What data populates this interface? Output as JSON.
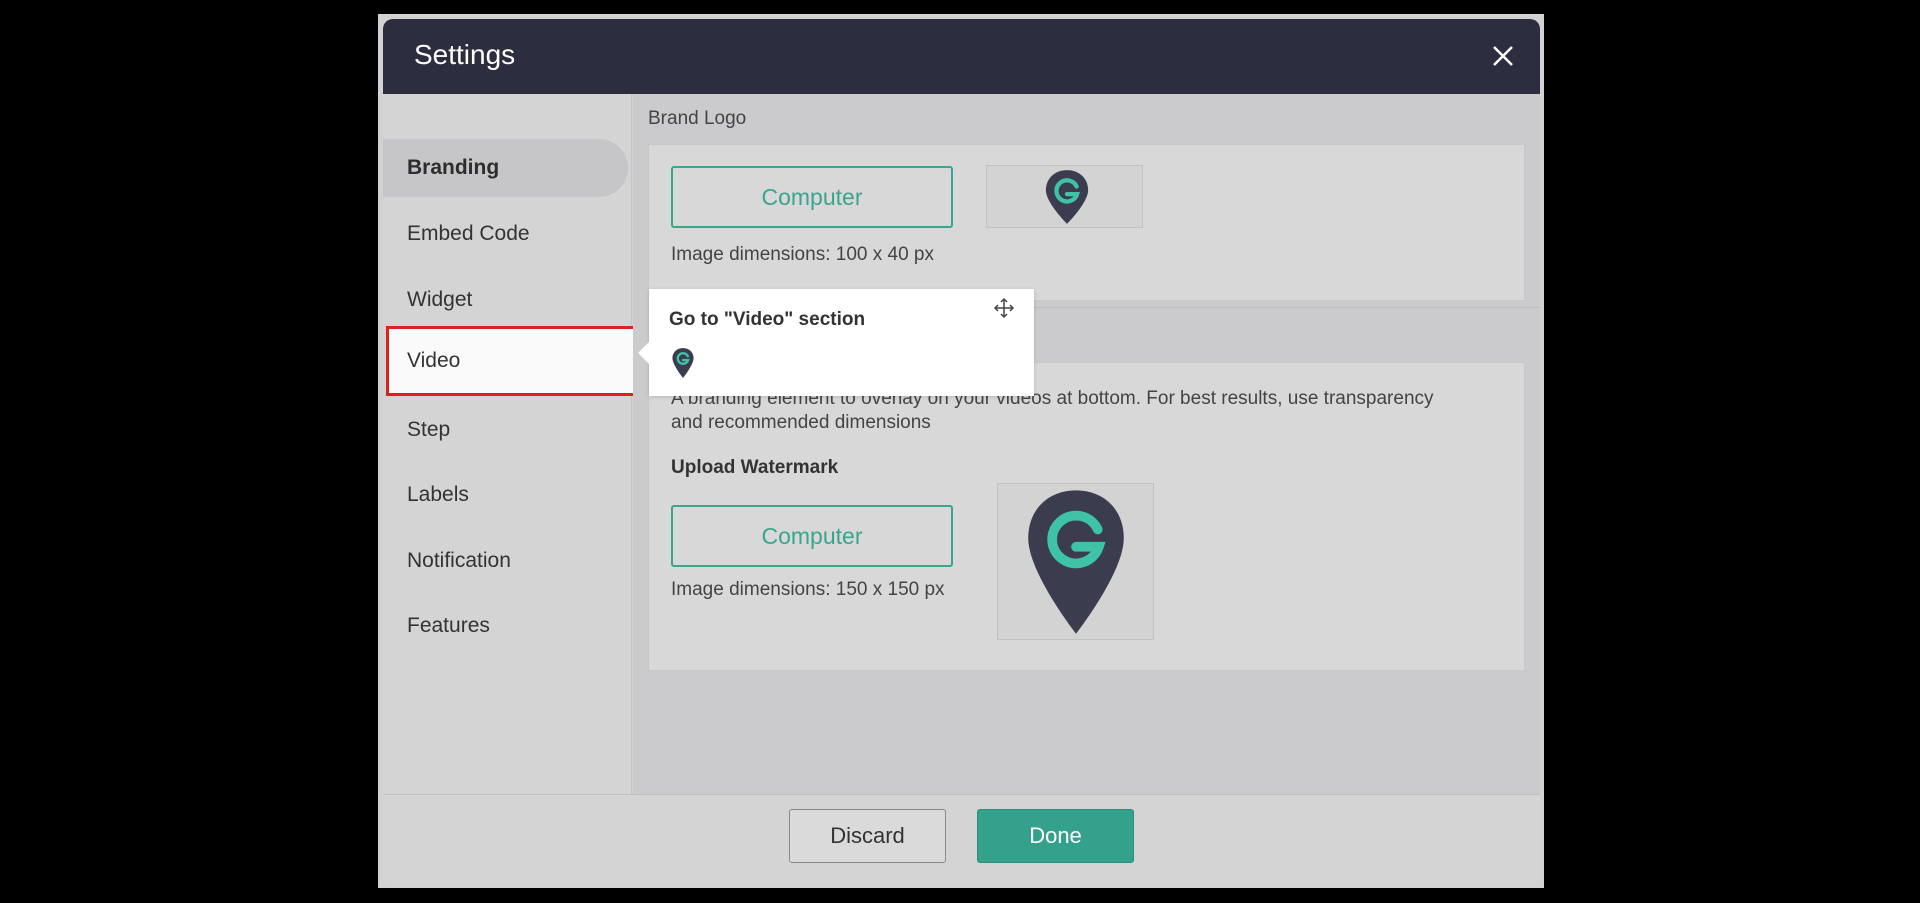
{
  "dialog": {
    "title": "Settings",
    "header_color": "#2c2d3f",
    "accent_color": "#33a18b"
  },
  "sidebar": {
    "items": [
      {
        "label": "Branding",
        "state": "active"
      },
      {
        "label": "Embed Code"
      },
      {
        "label": "Widget"
      },
      {
        "label": "Video",
        "state": "highlighted"
      },
      {
        "label": "Step"
      },
      {
        "label": "Labels"
      },
      {
        "label": "Notification"
      },
      {
        "label": "Features"
      }
    ]
  },
  "brand_logo": {
    "section_label": "Brand Logo",
    "upload_button": "Computer",
    "dimensions": "Image dimensions: 100 x 40 px",
    "preview_icon": "brand-location-pin-g-icon"
  },
  "watermark": {
    "description_line1": "A branding element to overlay on your videos at bottom. For best results, use transparency",
    "description_line2": "and recommended dimensions",
    "upload_label": "Upload Watermark",
    "upload_button": "Computer",
    "dimensions": "Image dimensions: 150 x 150 px",
    "preview_icon": "watermark-location-pin-g-icon"
  },
  "footer": {
    "discard_label": "Discard",
    "done_label": "Done"
  },
  "tooltip": {
    "title": "Go to \"Video\" section",
    "move_icon": "move-icon",
    "logo_icon": "brand-location-pin-g-icon"
  }
}
